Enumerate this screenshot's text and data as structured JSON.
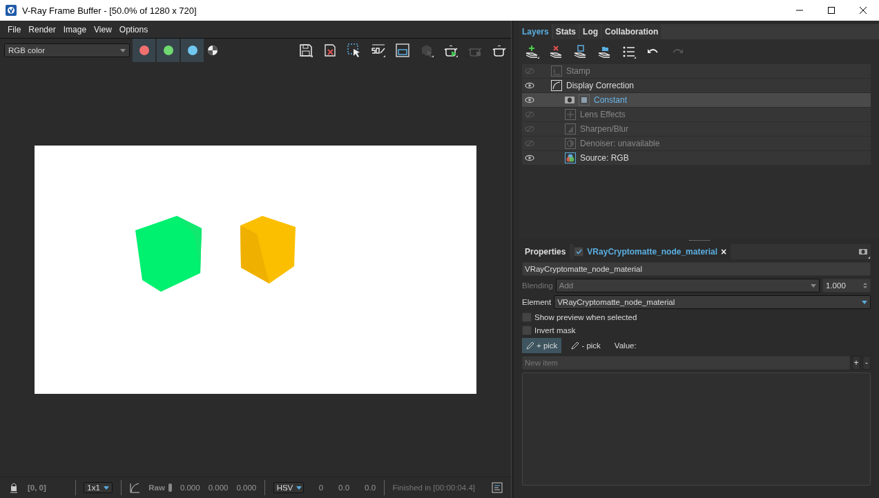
{
  "window": {
    "title": "V-Ray Frame Buffer - [50.0% of 1280 x 720]"
  },
  "menu": [
    "File",
    "Render",
    "Image",
    "View",
    "Options"
  ],
  "toolbar": {
    "channel": "RGB color",
    "channels": [
      {
        "color": "#f07070",
        "on": true
      },
      {
        "color": "#70d870",
        "on": true
      },
      {
        "color": "#70c8f0",
        "on": true
      }
    ]
  },
  "tabs": [
    {
      "label": "Layers",
      "selected": true
    },
    {
      "label": "Stats",
      "selected": false
    },
    {
      "label": "Log",
      "selected": false
    },
    {
      "label": "Collaboration",
      "selected": false
    }
  ],
  "layers": [
    {
      "label": "Stamp",
      "kind": "stamp",
      "visible": false,
      "selected": false
    },
    {
      "label": "Display Correction",
      "kind": "curve",
      "visible": true,
      "selected": false,
      "children": [
        {
          "label": "Constant",
          "kind": "constant",
          "visible": true,
          "selected": true
        },
        {
          "label": "Lens Effects",
          "kind": "lens",
          "visible": false,
          "selected": false
        },
        {
          "label": "Sharpen/Blur",
          "kind": "sharpen",
          "visible": false,
          "selected": false
        },
        {
          "label": "Denoiser: unavailable",
          "kind": "denoiser",
          "visible": false,
          "selected": false
        },
        {
          "label": "Source: RGB",
          "kind": "source",
          "visible": true,
          "selected": false
        }
      ]
    }
  ],
  "properties": {
    "title": "Properties",
    "node_tab": {
      "label": "VRayCryptomatte_node_material",
      "checked": true,
      "close": "×"
    },
    "name": "VRayCryptomatte_node_material",
    "blending": {
      "label": "Blending",
      "value": "Add",
      "amount": "1.000",
      "disabled": true
    },
    "element": {
      "label": "Element",
      "value": "VRayCryptomatte_node_material"
    },
    "checkboxes": [
      {
        "label": "Show preview when selected",
        "checked": false
      },
      {
        "label": "Invert mask",
        "checked": false
      }
    ],
    "pick_buttons": [
      {
        "label": "+ pick",
        "selected": true
      },
      {
        "label": "- pick",
        "selected": false
      }
    ],
    "value_label": "Value:",
    "new_item": {
      "placeholder": "New item"
    },
    "add": "+",
    "remove": "-"
  },
  "status_bar": {
    "coords": "[0, 0]",
    "zoom": "1x1",
    "raw": "Raw",
    "rgb": [
      "0.000",
      "0.000",
      "0.000"
    ],
    "mode": "HSV",
    "hsv": [
      "0",
      "0.0",
      "0.0"
    ],
    "status": "Finished in [00:00:04.4]"
  }
}
